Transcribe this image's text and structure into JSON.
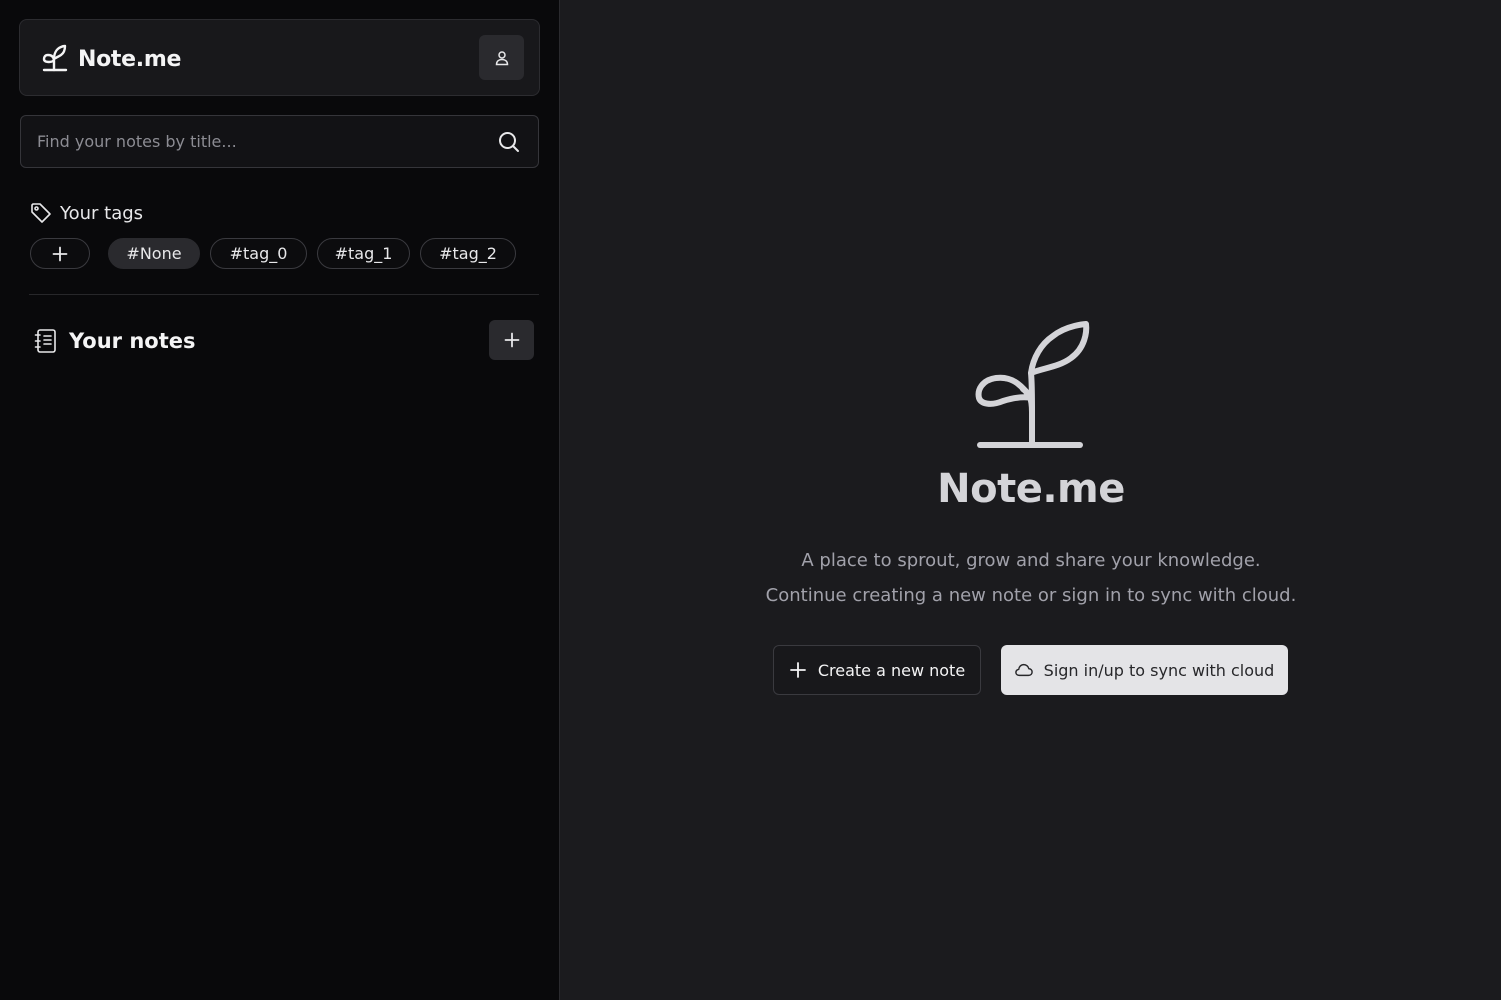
{
  "app": {
    "name": "Note.me"
  },
  "sidebar": {
    "search": {
      "placeholder": "Find your notes by title...",
      "value": ""
    },
    "tags": {
      "title": "Your tags",
      "add_label": "+",
      "items": [
        {
          "label": "#None",
          "active": true
        },
        {
          "label": "#tag_0",
          "active": false
        },
        {
          "label": "#tag_1",
          "active": false
        },
        {
          "label": "#tag_2",
          "active": false
        }
      ]
    },
    "notes": {
      "title": "Your notes",
      "add_label": "+",
      "items": []
    }
  },
  "main": {
    "title": "Note.me",
    "line1": "A place to sprout, grow and share your knowledge.",
    "line2": "Continue creating a new note or sign in to sync with cloud.",
    "create_label": "Create a new note",
    "sync_label": "Sign in/up to sync with cloud"
  },
  "icons": {
    "brand": "sprout-icon",
    "user": "user-icon",
    "search": "search-icon",
    "tags": "tag-icon",
    "notes": "notebook-icon",
    "create": "plus-icon",
    "sync": "cloud-icon"
  },
  "colors": {
    "sidebar_bg": "#09090b",
    "main_bg": "#1b1b1e",
    "accent_button": "#e4e4e7",
    "text": "#e8e8ea",
    "muted_text": "#a1a1aa"
  }
}
